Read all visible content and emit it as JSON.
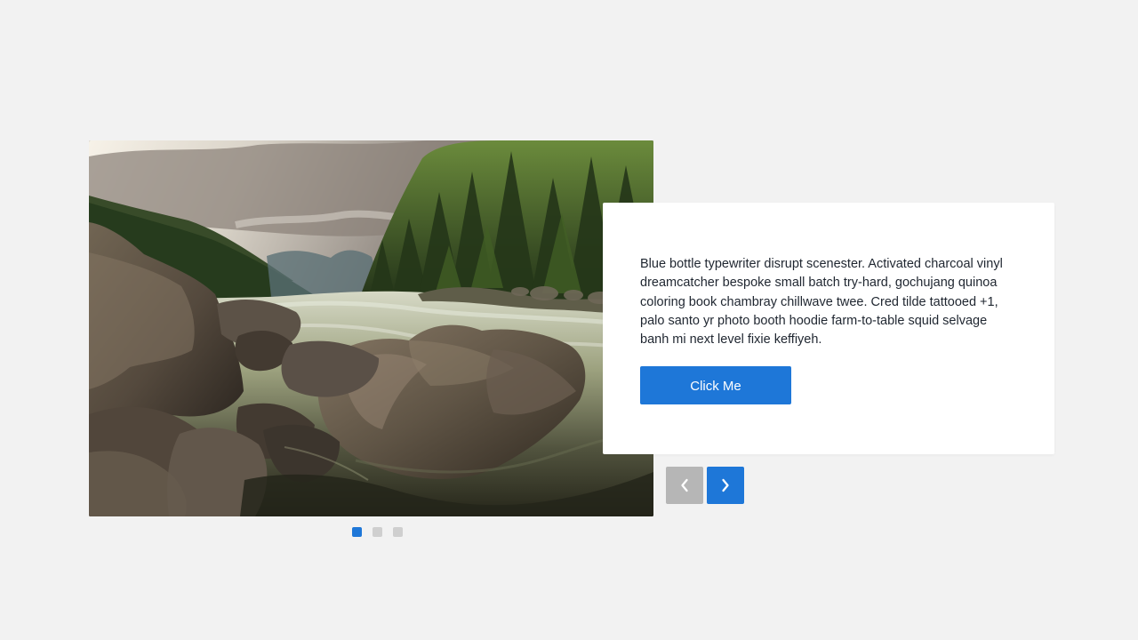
{
  "slide": {
    "image_alt": "Rocky river landscape with mountains and forest",
    "description": "Blue bottle typewriter disrupt scenester. Activated charcoal vinyl dreamcatcher bespoke small batch try-hard, gochujang quinoa coloring book chambray chillwave twee. Cred tilde tattooed +1, palo santo yr photo booth hoodie farm-to-table squid selvage banh mi next level fixie keffiyeh.",
    "button_label": "Click Me"
  },
  "navigation": {
    "prev_icon": "chevron-left-icon",
    "next_icon": "chevron-right-icon",
    "dots": [
      {
        "active": true
      },
      {
        "active": false
      },
      {
        "active": false
      }
    ]
  },
  "colors": {
    "background": "#f2f2f2",
    "accent": "#1e77d8",
    "disabled_nav": "#b6b6b6",
    "inactive_dot": "#cfcfcf",
    "card": "#ffffff",
    "text": "#1f2630"
  }
}
